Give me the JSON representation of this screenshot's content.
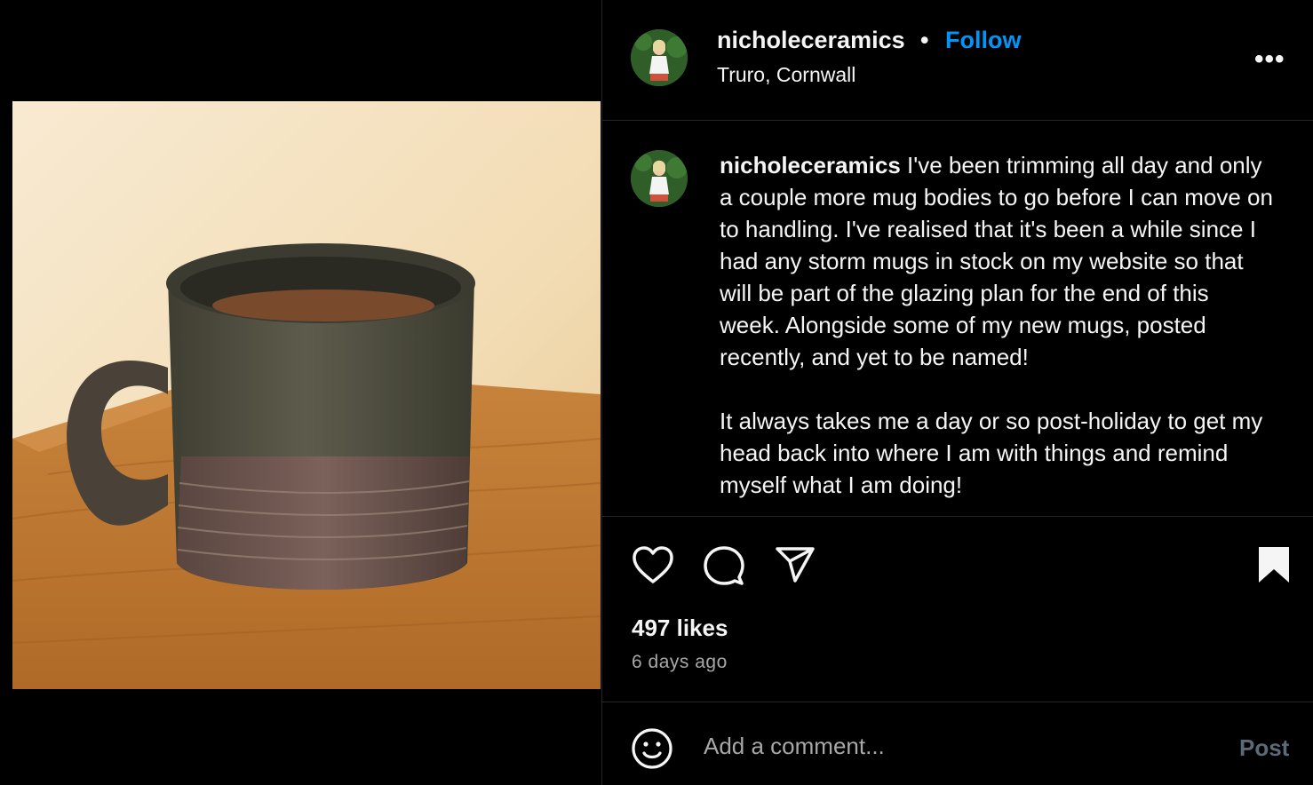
{
  "post": {
    "username": "nicholeceramics",
    "separator": "•",
    "follow_label": "Follow",
    "location": "Truro, Cornwall",
    "more_label": "•••",
    "caption_paragraph_1": "I've been trimming all day and only a couple more mug bodies to go before I can move on to handling. I've realised that it's been a while since I had any storm mugs in stock on my website so that will be part of the glazing plan for the end of this week. Alongside some of my new mugs, posted recently, and yet to be named!",
    "caption_paragraph_2": "It always takes me a day or so post-holiday to get my head back into where I am with things and remind myself what I am doing!",
    "likes": "497 likes",
    "timestamp": "6 days ago"
  },
  "comment": {
    "placeholder": "Add a comment...",
    "post_label": "Post"
  },
  "icons": {
    "like": "heart-icon",
    "comment": "speech-bubble-icon",
    "share": "paper-plane-icon",
    "save": "bookmark-icon",
    "emoji": "smiley-icon",
    "more": "ellipsis-icon"
  },
  "colors": {
    "accent": "#0095f6",
    "post_disabled": "#5c6a78",
    "secondary_text": "#a8a8a8",
    "divider": "#262626"
  }
}
